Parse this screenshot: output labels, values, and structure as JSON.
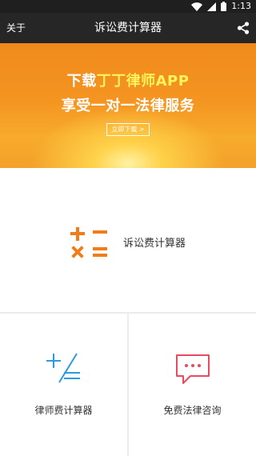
{
  "status_bar": {
    "time": "1:13",
    "icons": [
      "wifi-icon",
      "signal-icon",
      "battery-icon"
    ]
  },
  "app_bar": {
    "about_label": "关于",
    "title": "诉讼费计算器",
    "share_icon": "share-icon"
  },
  "banner": {
    "line1_prefix": "下载",
    "line1_highlight": "丁丁律师APP",
    "line2": "享受一对一法律服务",
    "download_button": "立即下载 >"
  },
  "main_tile": {
    "label": "诉讼费计算器",
    "icon": "calculator-icon"
  },
  "tiles": [
    {
      "label": "律师费计算器",
      "icon": "calculator-outline-icon"
    },
    {
      "label": "免费法律咨询",
      "icon": "chat-bubble-icon"
    }
  ],
  "colors": {
    "app_bar": "#262626",
    "accent_orange": "#f07d1c",
    "icon_blue": "#2b9be0",
    "icon_red": "#e84a5f",
    "banner_highlight": "#fff45a"
  }
}
